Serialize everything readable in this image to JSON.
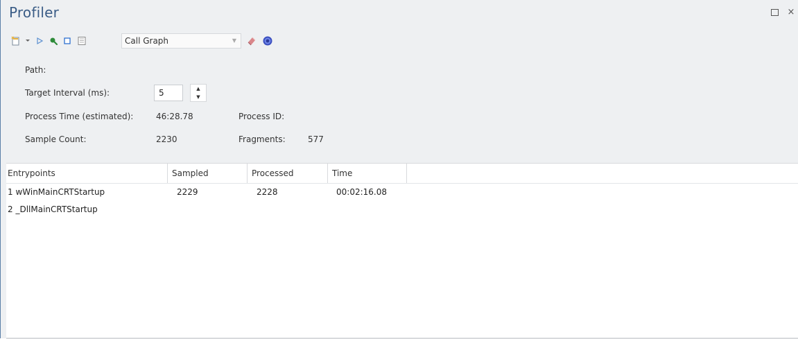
{
  "window": {
    "title": "Profiler",
    "buttons": [
      "maximize-icon",
      "close-icon"
    ],
    "close_glyph": "×"
  },
  "toolbar": {
    "icons": [
      "new-session-icon",
      "dropdown-arrow-icon",
      "run-icon",
      "attach-icon",
      "stop-icon",
      "report-icon",
      "eraser-icon",
      "help-icon"
    ],
    "view_select": {
      "value": "Call Graph"
    }
  },
  "fields": {
    "path_label": "Path:",
    "interval_label": "Target Interval (ms):",
    "interval_value": "5",
    "process_time_label": "Process Time (estimated):",
    "process_time_value": "46:28.78",
    "process_id_label": "Process ID:",
    "sample_count_label": "Sample Count:",
    "sample_count_value": "2230",
    "fragments_label": "Fragments:",
    "fragments_value": "577"
  },
  "table": {
    "columns": [
      "Entrypoints",
      "Sampled",
      "Processed",
      "Time"
    ],
    "rows": [
      {
        "entrypoint": "1 wWinMainCRTStartup",
        "sampled": "2229",
        "processed": "2228",
        "time": "00:02:16.08"
      },
      {
        "entrypoint": "2 _DllMainCRTStartup",
        "sampled": "",
        "processed": "",
        "time": ""
      }
    ]
  }
}
